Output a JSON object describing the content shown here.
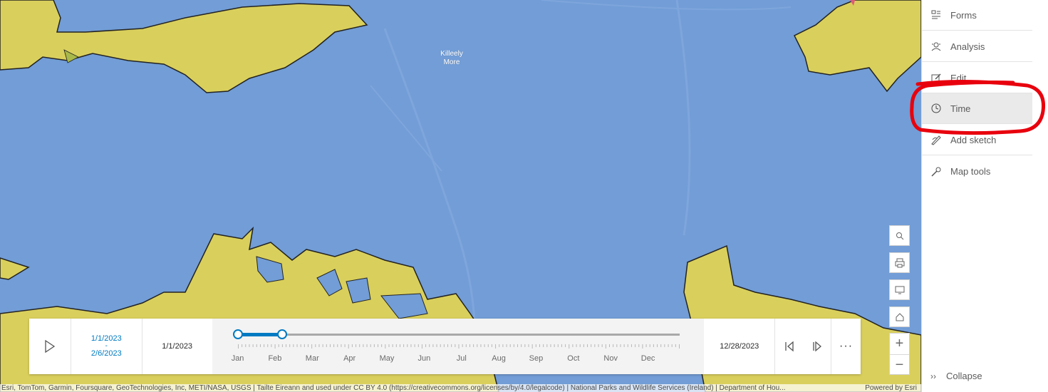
{
  "map": {
    "place_label": "Killeely More",
    "colors": {
      "water_zone": "#729dd6",
      "land_zone": "#d9cf5c",
      "outline": "#222222"
    }
  },
  "panel": {
    "items": [
      {
        "label": "Forms",
        "icon": "forms-icon"
      },
      {
        "label": "Analysis",
        "icon": "analysis-icon"
      },
      {
        "label": "Edit",
        "icon": "edit-icon"
      },
      {
        "label": "Time",
        "icon": "clock-icon",
        "active": true
      },
      {
        "label": "Add sketch",
        "icon": "sketch-icon"
      },
      {
        "label": "Map tools",
        "icon": "wrench-icon"
      }
    ],
    "collapse_label": "Collapse"
  },
  "widgets": [
    "search-icon",
    "print-icon",
    "fullscreen-icon",
    "home-icon",
    "zoom-in-icon",
    "zoom-out-icon"
  ],
  "zoom": {
    "in": "+",
    "out": "−"
  },
  "time_slider": {
    "range_start": "1/1/2023",
    "range_separator": "-",
    "range_end": "2/6/2023",
    "min_label": "1/1/2023",
    "max_label": "12/28/2023",
    "months": [
      "Jan",
      "Feb",
      "Mar",
      "Apr",
      "May",
      "Jun",
      "Jul",
      "Aug",
      "Sep",
      "Oct",
      "Nov",
      "Dec"
    ],
    "selection_fraction": [
      0.0,
      0.1
    ],
    "more": "···"
  },
  "attribution": {
    "text": "Esri, TomTom, Garmin, Foursquare, GeoTechnologies, Inc, METI/NASA, USGS | Tailte Éireann and used under CC BY 4.0 (https://creativecommons.org/licenses/by/4.0/legalcode) | National Parks and Wildlife Services (Ireland) | Department of Hou...",
    "powered": "Powered by Esri"
  },
  "annotation_color": "#e8000d"
}
